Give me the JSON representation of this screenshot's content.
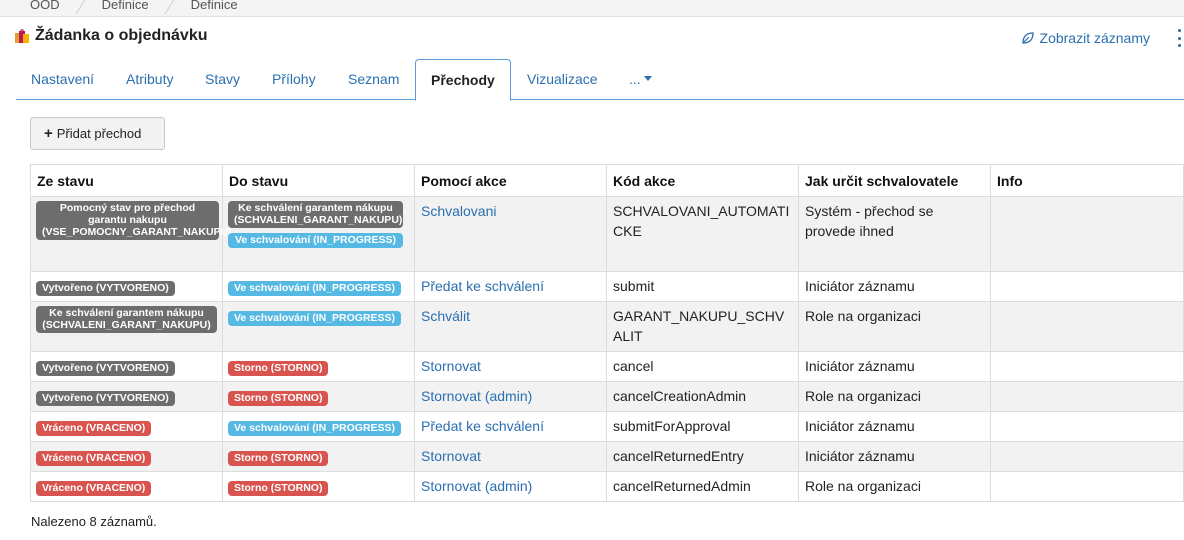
{
  "breadcrumb": [
    "OOD",
    "Definice",
    "Definice"
  ],
  "page": {
    "title": "Žádanka o objednávku"
  },
  "header_actions": {
    "show_records": "Zobrazit záznamy"
  },
  "tabs": [
    {
      "label": "Nastavení"
    },
    {
      "label": "Atributy"
    },
    {
      "label": "Stavy"
    },
    {
      "label": "Přílohy"
    },
    {
      "label": "Seznam"
    },
    {
      "label": "Přechody",
      "active": true
    },
    {
      "label": "Vizualizace"
    },
    {
      "label": "..."
    }
  ],
  "toolbar": {
    "add_label": "Přidat přechod"
  },
  "table": {
    "headers": [
      "Ze stavu",
      "Do stavu",
      "Pomocí akce",
      "Kód akce",
      "Jak určit schvalovatele",
      "Info"
    ],
    "rows": [
      {
        "from": [
          {
            "text": "Pomocný stav pro přechod garantu nakupu (VSE_POMOCNY_GARANT_NAKUPU)",
            "color": "gray"
          }
        ],
        "to": [
          {
            "text": "Ke schválení garantem nákupu (SCHVALENI_GARANT_NAKUPU)",
            "color": "gray"
          },
          {
            "text": "Ve schvalování (IN_PROGRESS)",
            "color": "blue"
          }
        ],
        "action": "Schvalovani",
        "code": "SCHVALOVANI_AUTOMATICKE",
        "approver": "Systém - přechod se provede ihned",
        "info": ""
      },
      {
        "from": [
          {
            "text": "Vytvořeno (VYTVORENO)",
            "color": "gray"
          }
        ],
        "to": [
          {
            "text": "Ve schvalování (IN_PROGRESS)",
            "color": "blue"
          }
        ],
        "action": "Předat ke schválení",
        "code": "submit",
        "approver": "Iniciátor záznamu",
        "info": ""
      },
      {
        "from": [
          {
            "text": "Ke schválení garantem nákupu (SCHVALENI_GARANT_NAKUPU)",
            "color": "gray"
          }
        ],
        "to": [
          {
            "text": "Ve schvalování (IN_PROGRESS)",
            "color": "blue"
          }
        ],
        "action": "Schválit",
        "code": "GARANT_NAKUPU_SCHVALIT",
        "approver": "Role na organizaci",
        "info": ""
      },
      {
        "from": [
          {
            "text": "Vytvořeno (VYTVORENO)",
            "color": "gray"
          }
        ],
        "to": [
          {
            "text": "Storno (STORNO)",
            "color": "red"
          }
        ],
        "action": "Stornovat",
        "code": "cancel",
        "approver": "Iniciátor záznamu",
        "info": ""
      },
      {
        "from": [
          {
            "text": "Vytvořeno (VYTVORENO)",
            "color": "gray"
          }
        ],
        "to": [
          {
            "text": "Storno (STORNO)",
            "color": "red"
          }
        ],
        "action": "Stornovat (admin)",
        "code": "cancelCreationAdmin",
        "approver": "Role na organizaci",
        "info": ""
      },
      {
        "from": [
          {
            "text": "Vráceno (VRACENO)",
            "color": "red"
          }
        ],
        "to": [
          {
            "text": "Ve schvalování (IN_PROGRESS)",
            "color": "blue"
          }
        ],
        "action": "Předat ke schválení",
        "code": "submitForApproval",
        "approver": "Iniciátor záznamu",
        "info": ""
      },
      {
        "from": [
          {
            "text": "Vráceno (VRACENO)",
            "color": "red"
          }
        ],
        "to": [
          {
            "text": "Storno (STORNO)",
            "color": "red"
          }
        ],
        "action": "Stornovat",
        "code": "cancelReturnedEntry",
        "approver": "Iniciátor záznamu",
        "info": ""
      },
      {
        "from": [
          {
            "text": "Vráceno (VRACENO)",
            "color": "red"
          }
        ],
        "to": [
          {
            "text": "Storno (STORNO)",
            "color": "red"
          }
        ],
        "action": "Stornovat (admin)",
        "code": "cancelReturnedAdmin",
        "approver": "Role na organizaci",
        "info": ""
      }
    ]
  },
  "footer": {
    "count_text": "Nalezeno 8 záznamů."
  },
  "colors": {
    "link": "#2a6fb0",
    "badge_gray": "#6d6d6d",
    "badge_blue": "#55b9e3",
    "badge_red": "#d9534f"
  },
  "icons": {
    "title_icon": "shopping-bags-icon",
    "show_records_icon": "leaf-icon",
    "menu_icon": "kebab-menu-icon"
  }
}
